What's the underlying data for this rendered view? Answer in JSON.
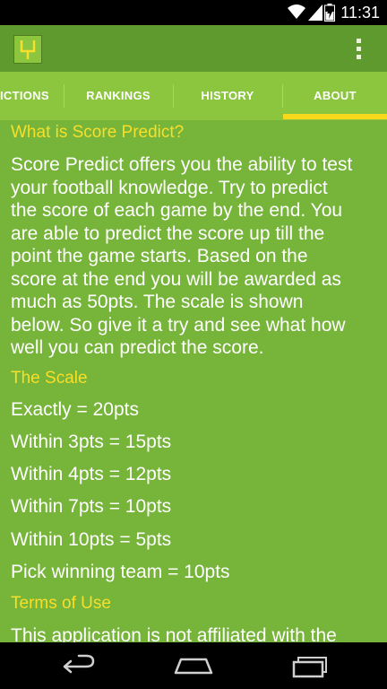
{
  "status_bar": {
    "time": "11:31",
    "icons": [
      "wifi-icon",
      "signal-icon",
      "battery-icon"
    ]
  },
  "action_bar": {
    "logo_icon": "goalpost-icon",
    "overflow_icon": "overflow-menu-icon"
  },
  "tabs": [
    {
      "label": "PREDICTIONS",
      "visible_label": "ICTIONS"
    },
    {
      "label": "RANKINGS"
    },
    {
      "label": "HISTORY"
    },
    {
      "label": "ABOUT",
      "selected": true
    }
  ],
  "about": {
    "what_heading": "What is Score Predict?",
    "what_lines": [
      "Score Predict offers you the ability to test",
      "your football knowledge. Try to predict",
      "the score of each game by the end. You",
      "are able to predict the score up till the",
      "point the game starts. Based on the",
      "score at the end you will be awarded as",
      "much as 50pts. The scale is shown",
      "below. So give it a try and see what how",
      "well you can predict the score."
    ],
    "scale_heading": "The Scale",
    "scale_items": [
      "Exactly = 20pts",
      "Within 3pts = 15pts",
      "Within 4pts = 12pts",
      "Within 7pts = 10pts",
      "Within 10pts = 5pts",
      "Pick winning team = 10pts"
    ],
    "terms_heading": "Terms of Use",
    "terms_text": "This application is not affiliated with the"
  },
  "nav_bar": {
    "buttons": [
      "back-icon",
      "home-icon",
      "recent-apps-icon"
    ]
  },
  "colors": {
    "background": "#77b43a",
    "action_bar": "#5f9a2e",
    "tab_bar": "#8cc63f",
    "heading": "#f7df2a",
    "tab_indicator": "#f7d81a"
  }
}
